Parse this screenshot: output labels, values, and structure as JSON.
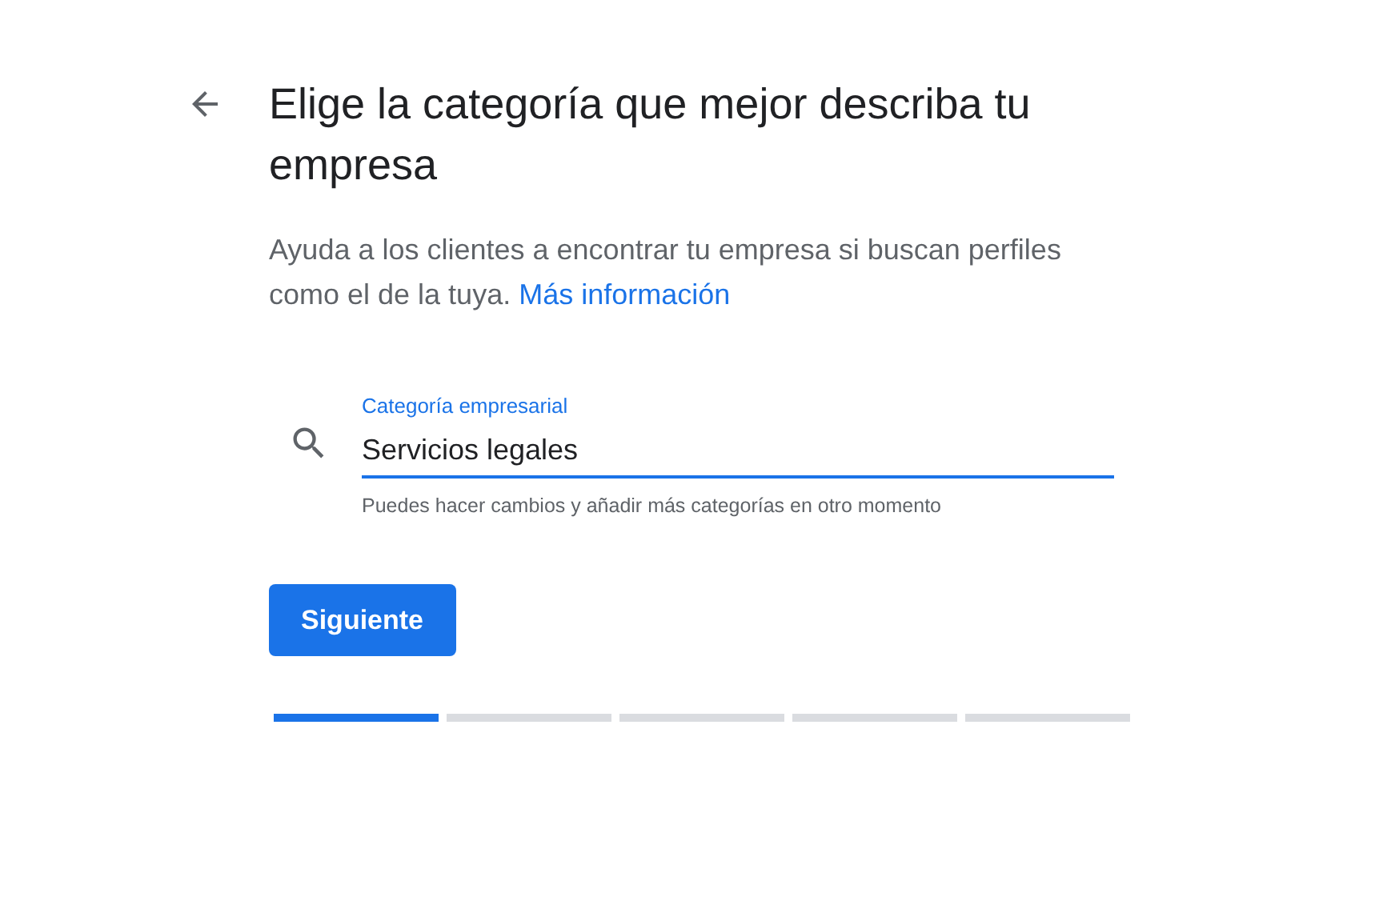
{
  "title": "Elige la categoría que mejor describa tu empresa",
  "description": {
    "text": "Ayuda a los clientes a encontrar tu empresa si buscan perfiles como el de la tuya.",
    "link": "Más información"
  },
  "field": {
    "label": "Categoría empresarial",
    "value": "Servicios legales",
    "helper": "Puedes hacer cambios y añadir más categorías en otro momento"
  },
  "button": "Siguiente",
  "steps": [
    {
      "selected": true
    },
    {
      "selected": false
    },
    {
      "selected": false
    },
    {
      "selected": false
    },
    {
      "selected": false
    }
  ]
}
